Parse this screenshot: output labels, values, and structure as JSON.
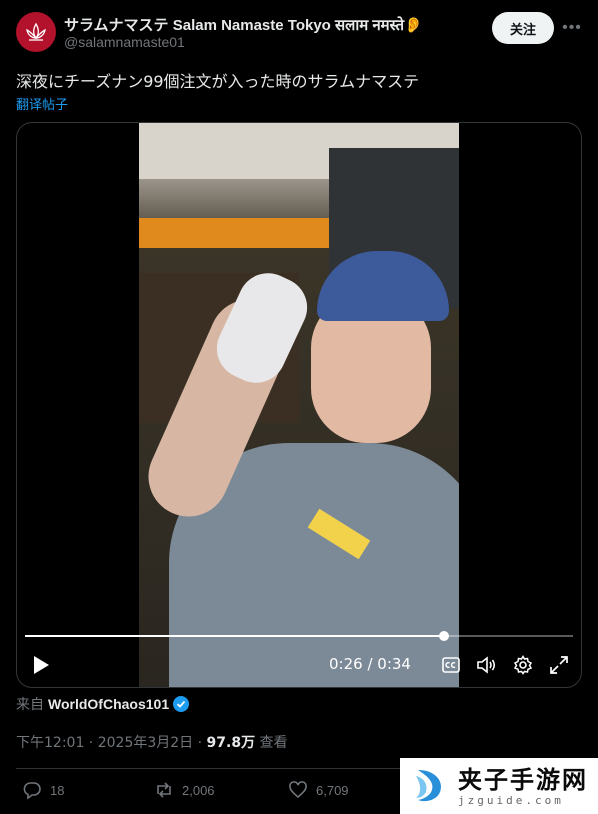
{
  "author": {
    "display_name": "サラムナマステ Salam Namaste Tokyo सलाम नमस्ते👂🧅...",
    "handle": "@salamnamaste01",
    "avatar_icon": "lotus-icon",
    "avatar_color": "#b3122d"
  },
  "header": {
    "follow_label": "关注",
    "more_icon": "more-dots-icon"
  },
  "tweet": {
    "text": "深夜にチーズナン99個注文が入った時のサラムナマステ",
    "translate_label": "翻译帖子"
  },
  "video": {
    "current_time": "0:26",
    "time_separator": " / ",
    "duration": "0:34",
    "progress": 0.765,
    "controls": [
      "play-icon",
      "captions-icon",
      "volume-icon",
      "settings-icon",
      "fullscreen-icon"
    ]
  },
  "source": {
    "label": "来自",
    "account": "WorldOfChaos101",
    "verified_color": "#1d9bf0"
  },
  "meta": {
    "time": "下午12:01",
    "sep": " · ",
    "date": "2025年3月2日",
    "views": "97.8万",
    "views_label": "查看"
  },
  "actions": {
    "replies": "18",
    "reposts": "2,006",
    "likes": "6,709"
  },
  "watermark": {
    "title": "夹子手游网",
    "domain": "jzguide.com"
  },
  "colors": {
    "background": "#000000",
    "text": "#e7e9ea",
    "muted": "#71767b",
    "link": "#1d9bf0"
  }
}
